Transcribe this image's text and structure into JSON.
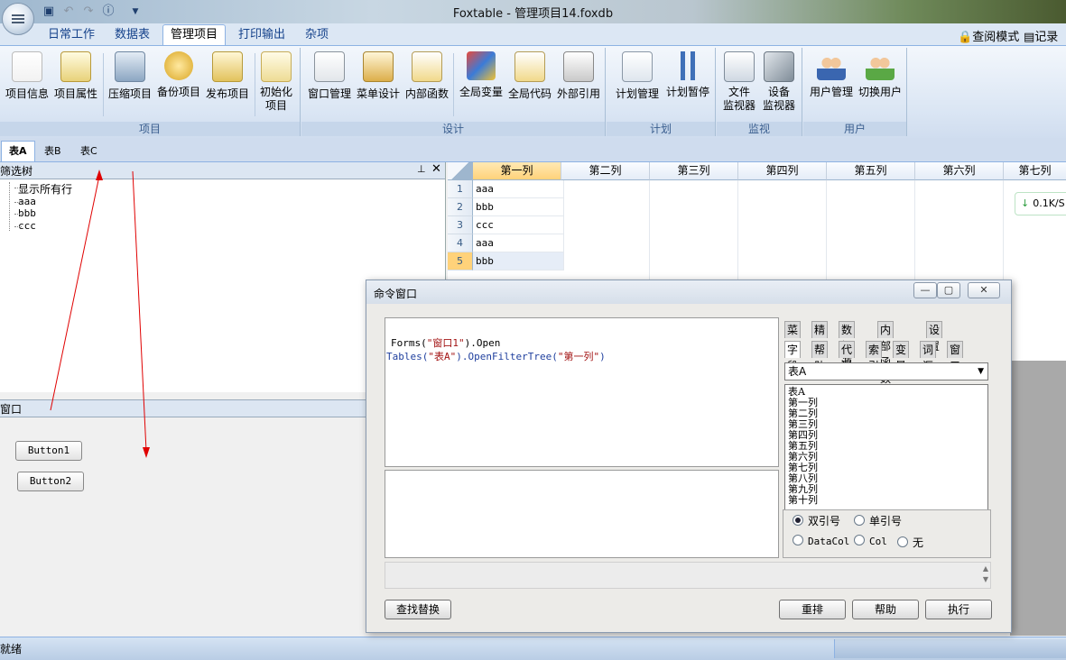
{
  "window": {
    "title": "Foxtable - 管理项目14.foxdb"
  },
  "ribbon_tabs": [
    "日常工作",
    "数据表",
    "管理项目",
    "打印输出",
    "杂项"
  ],
  "right_tools": {
    "query_mode": "查阅模式",
    "record_window": "记录窗"
  },
  "ribbon": {
    "groups": [
      {
        "label": "项目",
        "buttons": [
          "项目信息",
          "项目属性",
          "压缩项目",
          "备份项目",
          "发布项目",
          "初始化",
          "项目"
        ]
      },
      {
        "label": "设计",
        "buttons": [
          "窗口管理",
          "菜单设计",
          "内部函数",
          "全局变量",
          "全局代码",
          "外部引用"
        ]
      },
      {
        "label": "计划",
        "buttons": [
          "计划管理",
          "计划暂停"
        ]
      },
      {
        "label": "监视",
        "buttons": [
          "文件",
          "监视器",
          "设备",
          "监视器"
        ]
      },
      {
        "label": "用户",
        "buttons": [
          "用户管理",
          "切换用户"
        ]
      }
    ]
  },
  "doc_tabs": [
    "表A",
    "表B",
    "表C"
  ],
  "filter_tree": {
    "title": "筛选树",
    "items": [
      "显示所有行",
      "aaa",
      "bbb",
      "ccc"
    ]
  },
  "window_panel": {
    "title": "窗口",
    "buttons": [
      "Button1",
      "Button2"
    ]
  },
  "grid": {
    "columns": [
      "第一列",
      "第二列",
      "第三列",
      "第四列",
      "第五列",
      "第六列",
      "第七列"
    ],
    "rows": [
      {
        "num": "1",
        "val": "aaa"
      },
      {
        "num": "2",
        "val": "bbb"
      },
      {
        "num": "3",
        "val": "ccc"
      },
      {
        "num": "4",
        "val": "aaa"
      },
      {
        "num": "5",
        "val": "bbb"
      }
    ]
  },
  "speed_badge": "0.1K/S",
  "command_window": {
    "title": "命令窗口",
    "code": {
      "l1_a": "Forms(",
      "l1_s": "\"窗口1\"",
      "l1_b": ").Open",
      "l2_a": "Tables(",
      "l2_s1": "\"表A\"",
      "l2_b": ").OpenFilterTree(",
      "l2_s2": "\"第一列\"",
      "l2_c": ")"
    },
    "tabs_row1": [
      "菜单",
      "精灵",
      "数据源",
      "内部函数",
      "设置"
    ],
    "tabs_row2": [
      "字段",
      "帮助",
      "代码",
      "索引",
      "变量",
      "词汇",
      "窗口"
    ],
    "table_select": "表A",
    "fields": [
      "表A",
      "第一列",
      "第二列",
      "第三列",
      "第四列",
      "第五列",
      "第六列",
      "第七列",
      "第八列",
      "第九列",
      "第十列"
    ],
    "quote_options": [
      "双引号",
      "单引号"
    ],
    "ref_options": [
      "DataCol",
      "Col",
      "无"
    ],
    "buttons": {
      "find_replace": "查找替换",
      "rearrange": "重排",
      "help": "帮助",
      "execute": "执行"
    }
  },
  "status": {
    "text": "就绪"
  },
  "colors": {
    "accent": "#15428b",
    "ribbon_border": "#8db2e3",
    "selected_header": "#ffd27a",
    "string": "#a31515",
    "arrow": "#e00000"
  }
}
